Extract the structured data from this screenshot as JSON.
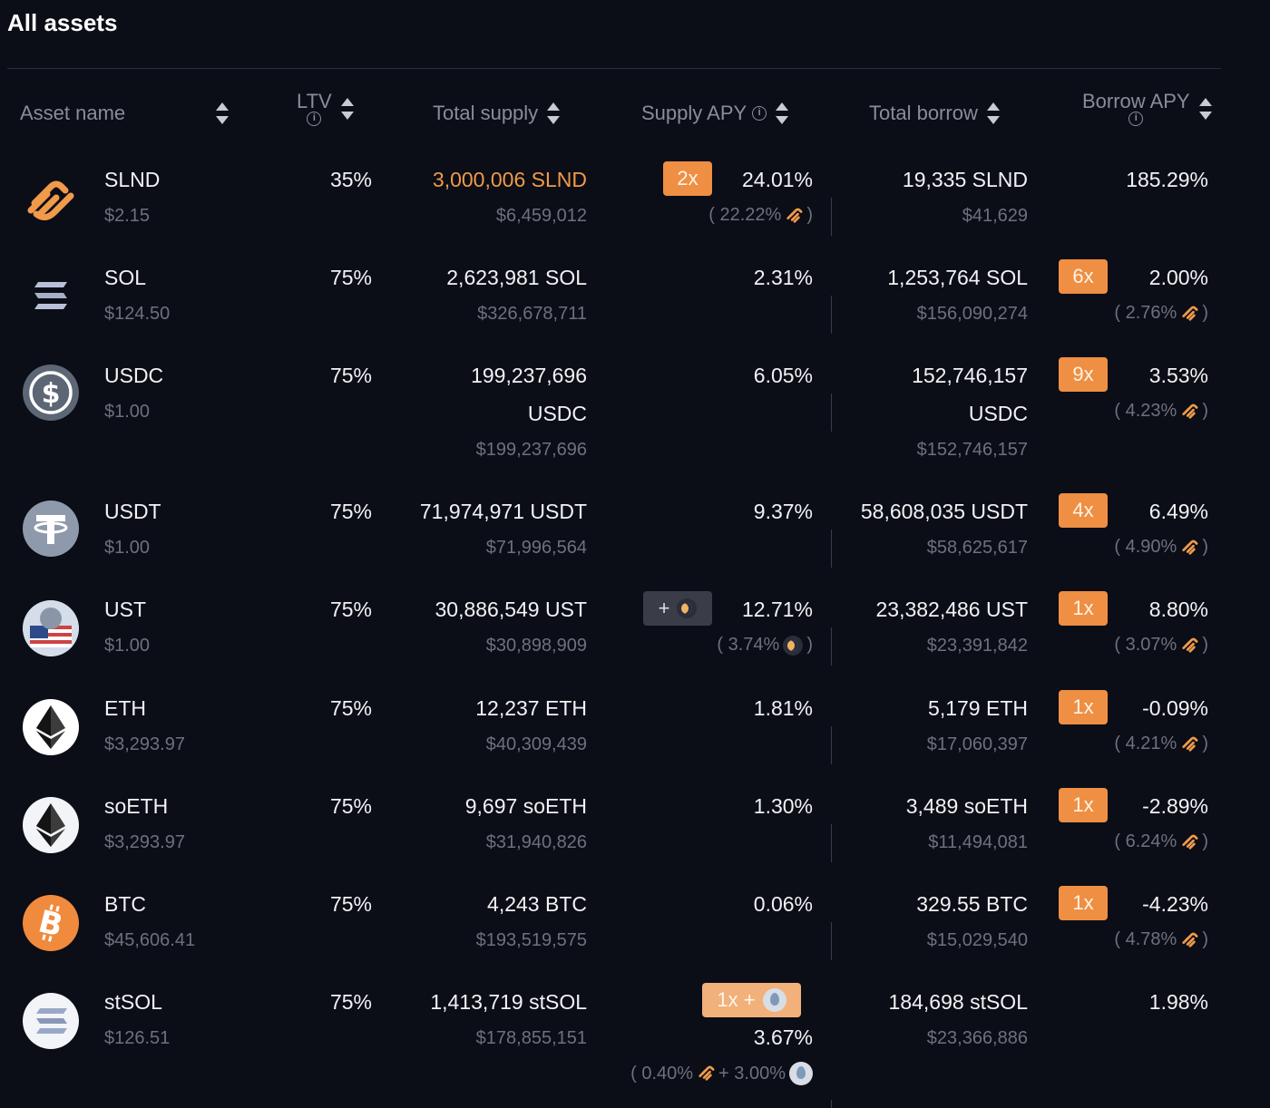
{
  "page_title": "All assets",
  "headers": {
    "asset_name": "Asset name",
    "ltv": "LTV",
    "total_supply": "Total supply",
    "supply_apy": "Supply APY",
    "total_borrow": "Total borrow",
    "borrow_apy": "Borrow APY"
  },
  "colors": {
    "accent": "#ee8f43",
    "background": "#0b0d17",
    "muted": "#6e717d"
  },
  "rows": [
    {
      "symbol": "SLND",
      "price": "$2.15",
      "ltv": "35%",
      "icon": "slnd-icon",
      "supply_amount": "3,000,006 SLND",
      "supply_usd": "$6,459,012",
      "supply_badge": "2x",
      "supply_apy": "24.01%",
      "supply_reward": "( 22.22%",
      "borrow_amount": "19,335 SLND",
      "borrow_usd": "$41,629",
      "borrow_apy": "185.29%"
    },
    {
      "symbol": "SOL",
      "price": "$124.50",
      "ltv": "75%",
      "icon": "sol-icon",
      "supply_amount": "2,623,981 SOL",
      "supply_usd": "$326,678,711",
      "supply_apy": "2.31%",
      "borrow_amount": "1,253,764 SOL",
      "borrow_usd": "$156,090,274",
      "borrow_badge": "6x",
      "borrow_apy": "2.00%",
      "borrow_reward": "( 2.76%"
    },
    {
      "symbol": "USDC",
      "price": "$1.00",
      "ltv": "75%",
      "icon": "usdc-icon",
      "supply_amount_1": "199,237,696",
      "supply_amount_2": "USDC",
      "supply_usd": "$199,237,696",
      "supply_apy": "6.05%",
      "borrow_amount_1": "152,746,157",
      "borrow_amount_2": "USDC",
      "borrow_usd": "$152,746,157",
      "borrow_badge": "9x",
      "borrow_apy": "3.53%",
      "borrow_reward": "( 4.23%"
    },
    {
      "symbol": "USDT",
      "price": "$1.00",
      "ltv": "75%",
      "icon": "usdt-icon",
      "supply_amount": "71,974,971 USDT",
      "supply_usd": "$71,996,564",
      "supply_apy": "9.37%",
      "borrow_amount": "58,608,035 USDT",
      "borrow_usd": "$58,625,617",
      "borrow_badge": "4x",
      "borrow_apy": "6.49%",
      "borrow_reward": "( 4.90%"
    },
    {
      "symbol": "UST",
      "price": "$1.00",
      "ltv": "75%",
      "icon": "ust-icon",
      "supply_amount": "30,886,549 UST",
      "supply_usd": "$30,898,909",
      "supply_badge": "+",
      "supply_apy": "12.71%",
      "supply_reward": "( 3.74%",
      "borrow_amount": "23,382,486 UST",
      "borrow_usd": "$23,391,842",
      "borrow_badge": "1x",
      "borrow_apy": "8.80%",
      "borrow_reward": "( 3.07%"
    },
    {
      "symbol": "ETH",
      "price": "$3,293.97",
      "ltv": "75%",
      "icon": "eth-icon",
      "supply_amount": "12,237 ETH",
      "supply_usd": "$40,309,439",
      "supply_apy": "1.81%",
      "borrow_amount": "5,179 ETH",
      "borrow_usd": "$17,060,397",
      "borrow_badge": "1x",
      "borrow_apy": "-0.09%",
      "borrow_reward": "( 4.21%"
    },
    {
      "symbol": "soETH",
      "price": "$3,293.97",
      "ltv": "75%",
      "icon": "soeth-icon",
      "supply_amount": "9,697 soETH",
      "supply_usd": "$31,940,826",
      "supply_apy": "1.30%",
      "borrow_amount": "3,489 soETH",
      "borrow_usd": "$11,494,081",
      "borrow_badge": "1x",
      "borrow_apy": "-2.89%",
      "borrow_reward": "( 6.24%"
    },
    {
      "symbol": "BTC",
      "price": "$45,606.41",
      "ltv": "75%",
      "icon": "btc-icon",
      "supply_amount": "4,243 BTC",
      "supply_usd": "$193,519,575",
      "supply_apy": "0.06%",
      "borrow_amount": "329.55 BTC",
      "borrow_usd": "$15,029,540",
      "borrow_badge": "1x",
      "borrow_apy": "-4.23%",
      "borrow_reward": "( 4.78%"
    },
    {
      "symbol": "stSOL",
      "price": "$126.51",
      "ltv": "75%",
      "icon": "stsol-icon",
      "supply_amount": "1,413,719 stSOL",
      "supply_usd": "$178,855,151",
      "supply_badge": "1x +",
      "supply_apy": "3.67%",
      "supply_reward": "( 0.40%",
      "supply_reward_extra": "+ 3.00%",
      "borrow_amount": "184,698 stSOL",
      "borrow_usd": "$23,366,886",
      "borrow_apy": "1.98%"
    }
  ],
  "close_paren": ")"
}
